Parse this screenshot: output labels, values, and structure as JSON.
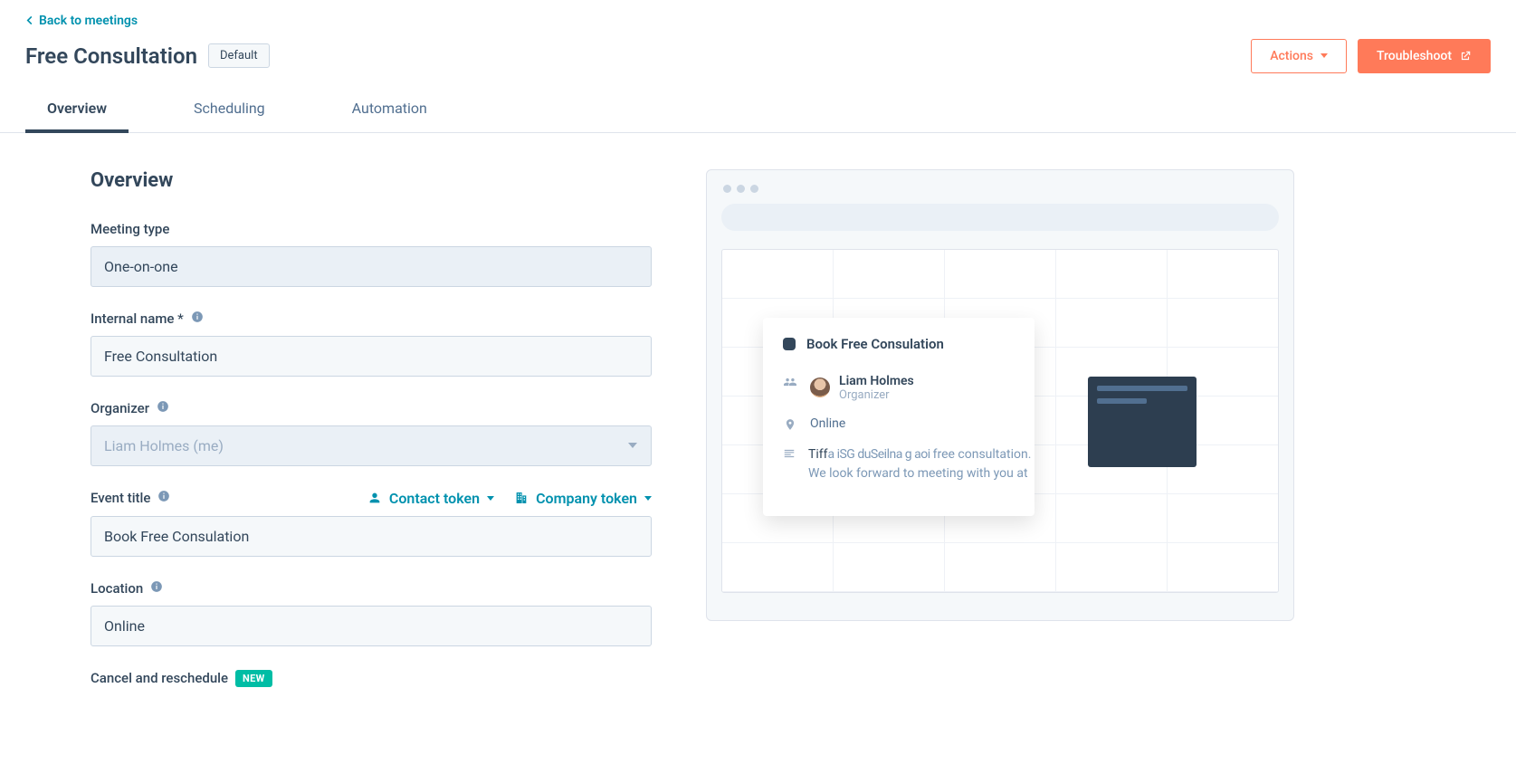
{
  "header": {
    "back_link": "Back to meetings",
    "title": "Free Consultation",
    "default_badge": "Default",
    "actions_button": "Actions",
    "troubleshoot_button": "Troubleshoot"
  },
  "tabs": [
    {
      "label": "Overview",
      "active": true
    },
    {
      "label": "Scheduling",
      "active": false
    },
    {
      "label": "Automation",
      "active": false
    }
  ],
  "overview": {
    "section_title": "Overview",
    "meeting_type": {
      "label": "Meeting type",
      "value": "One-on-one"
    },
    "internal_name": {
      "label": "Internal name *",
      "value": "Free Consultation"
    },
    "organizer": {
      "label": "Organizer",
      "value": "Liam Holmes (me)"
    },
    "event_title": {
      "label": "Event title",
      "contact_token": "Contact token",
      "company_token": "Company token",
      "value": "Book Free Consulation"
    },
    "location": {
      "label": "Location",
      "value": "Online"
    },
    "cancel_reschedule": {
      "label": "Cancel and reschedule",
      "new_pill": "NEW"
    }
  },
  "preview": {
    "popover_title": "Book Free Consulation",
    "organizer_name": "Liam Holmes",
    "organizer_role": "Organizer",
    "location": "Online",
    "description_line1": "free consultation.",
    "description_line2": "We look forward to meeting with you at"
  }
}
